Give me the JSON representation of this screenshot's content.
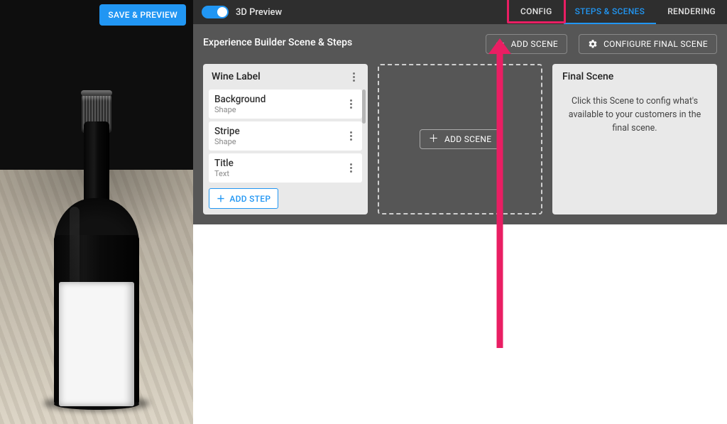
{
  "left": {
    "save_preview_label": "SAVE & PREVIEW"
  },
  "topbar": {
    "preview_label": "3D Preview",
    "tabs": {
      "config": "CONFIG",
      "steps_scenes": "STEPS & SCENES",
      "rendering": "RENDERING"
    }
  },
  "toolbar": {
    "section_title": "Experience Builder Scene & Steps",
    "add_scene_label": "ADD SCENE",
    "configure_final_label": "CONFIGURE FINAL SCENE"
  },
  "scene": {
    "name": "Wine Label",
    "steps": [
      {
        "title": "Background",
        "type": "Shape"
      },
      {
        "title": "Stripe",
        "type": "Shape"
      },
      {
        "title": "Title",
        "type": "Text"
      }
    ],
    "add_step_label": "ADD STEP"
  },
  "placeholder": {
    "add_scene_label": "ADD SCENE"
  },
  "final": {
    "title": "Final Scene",
    "description": "Click this Scene to config what's available to your customers in the final scene."
  },
  "annotation": {
    "color": "#e91e63",
    "points_to": "config-tab"
  }
}
